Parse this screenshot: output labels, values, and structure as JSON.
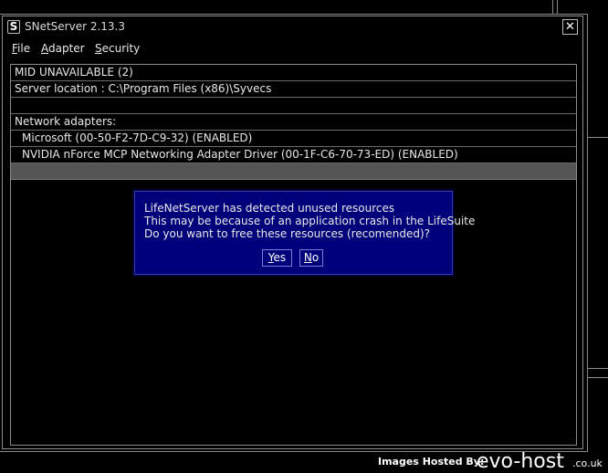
{
  "window": {
    "title": "SNetServer 2.13.3",
    "app_icon_glyph": "S",
    "close_glyph": "✕"
  },
  "menu": {
    "file": {
      "accel": "F",
      "rest": "ile"
    },
    "adapter": {
      "accel": "A",
      "rest": "dapter"
    },
    "security": {
      "accel": "S",
      "rest": "ecurity"
    }
  },
  "list": {
    "rows": [
      "MID UNAVAILABLE (2)",
      "Server location : C:\\Program Files (x86)\\Syvecs",
      "",
      "Network adapters:",
      "Microsoft (00-50-F2-7D-C9-32) (ENABLED)",
      "NVIDIA nForce MCP Networking Adapter Driver (00-1F-C6-70-73-ED) (ENABLED)",
      ""
    ]
  },
  "dialog": {
    "lines": [
      "LifeNetServer has detected unused resources",
      "This may be because of an application crash in the LifeSuite",
      "Do you want to free these resources (recomended)?"
    ],
    "yes": {
      "accel": "Y",
      "rest": "es"
    },
    "no": {
      "accel": "N",
      "rest": "o"
    }
  },
  "footer": {
    "label": "Images Hosted By:",
    "brand": "evo-host",
    "tld": ".co.uk"
  },
  "colors": {
    "background": "#000000",
    "dialog": "#00007a",
    "highlight_row": "#555555",
    "border": "#8c8c8c"
  }
}
